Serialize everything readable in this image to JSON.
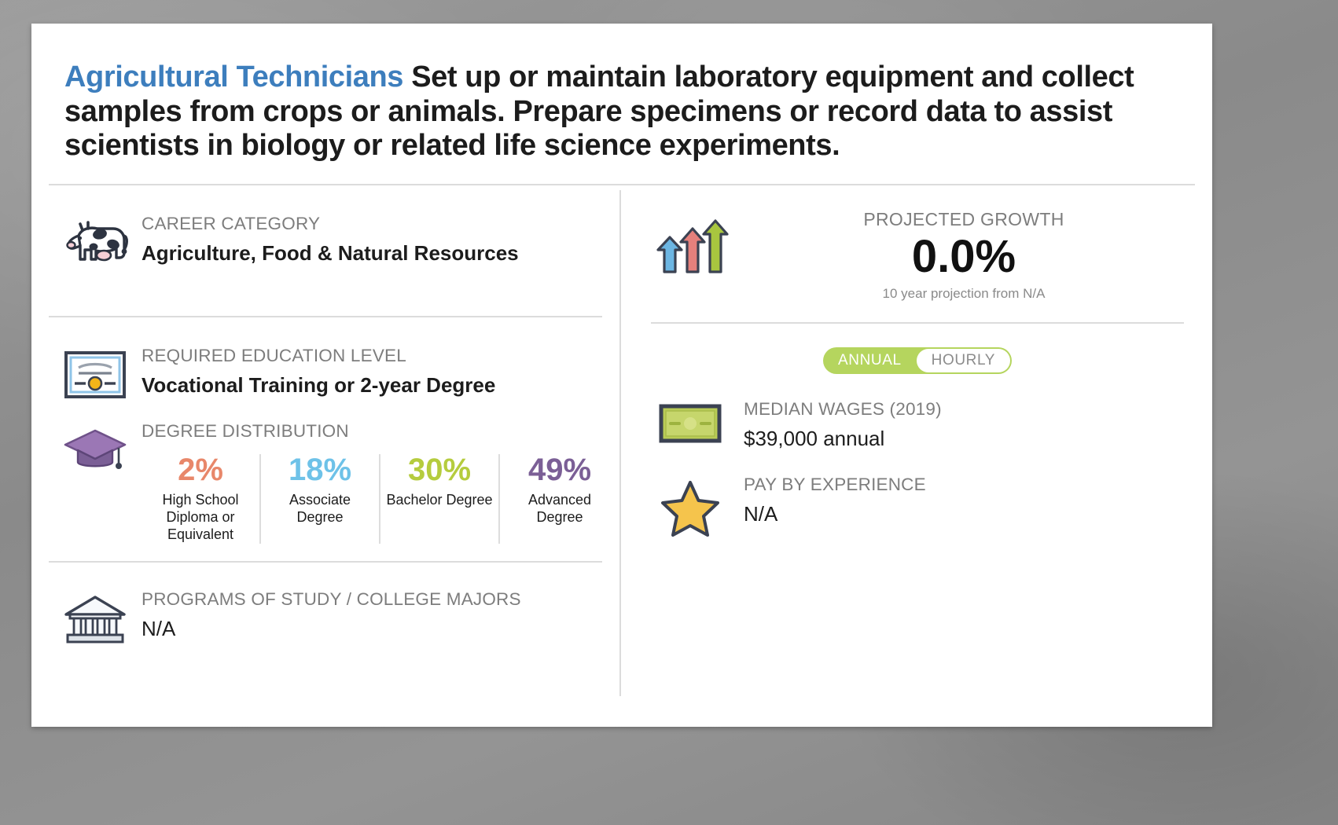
{
  "header": {
    "job_title": "Agricultural Technicians",
    "description": "Set up or maintain laboratory equipment and collect samples from crops or animals. Prepare specimens or record data to assist scientists in biology or related life science experiments."
  },
  "left": {
    "career_category": {
      "icon": "cow-icon",
      "label": "CAREER CATEGORY",
      "value": "Agriculture, Food & Natural Resources"
    },
    "education": {
      "icon": "certificate-icon",
      "label": "REQUIRED EDUCATION LEVEL",
      "value": "Vocational Training or 2-year Degree"
    },
    "degree_distribution": {
      "icon": "graduation-cap-icon",
      "label": "DEGREE DISTRIBUTION",
      "items": [
        {
          "pct": "2%",
          "name": "High School Diploma or Equivalent",
          "color": "#e8876a"
        },
        {
          "pct": "18%",
          "name": "Associate Degree",
          "color": "#6ec2e8"
        },
        {
          "pct": "30%",
          "name": "Bachelor Degree",
          "color": "#b5cc3e"
        },
        {
          "pct": "49%",
          "name": "Advanced Degree",
          "color": "#7b5f96"
        }
      ]
    },
    "programs": {
      "icon": "bank-building-icon",
      "label": "PROGRAMS OF STUDY / COLLEGE MAJORS",
      "value": "N/A"
    }
  },
  "right": {
    "projected_growth": {
      "icon": "growth-arrows-icon",
      "label": "PROJECTED GROWTH",
      "value": "0.0%",
      "sub": "10 year projection from N/A"
    },
    "wage_toggle": {
      "annual": "ANNUAL",
      "hourly": "HOURLY",
      "selected": "ANNUAL"
    },
    "median_wages": {
      "icon": "money-bill-icon",
      "label": "MEDIAN WAGES (2019)",
      "value": "$39,000 annual"
    },
    "pay_by_experience": {
      "icon": "star-icon",
      "label": "PAY BY EXPERIENCE",
      "value": "N/A"
    }
  },
  "colors": {
    "job_title": "#3d7ebd",
    "label_gray": "#7d7d7d",
    "toggle_green": "#b5d55e",
    "star_gold": "#f5c44c"
  }
}
